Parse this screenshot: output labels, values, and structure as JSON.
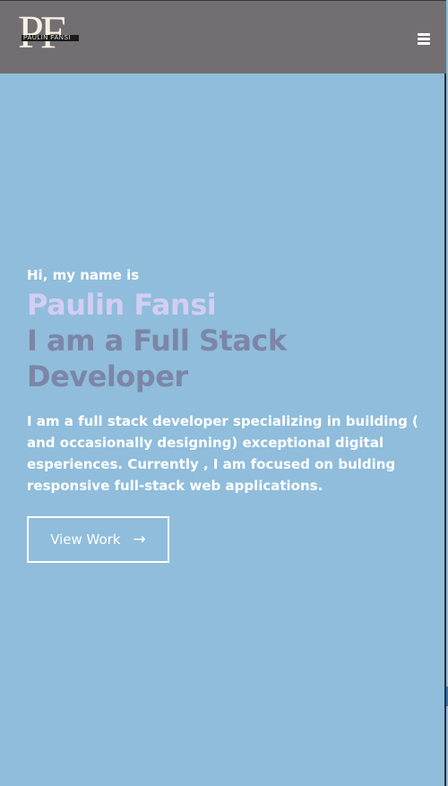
{
  "header": {
    "logo_letters": "PF",
    "logo_text": "PAULIN FANSI",
    "menu_icon": "hamburger-menu-icon"
  },
  "hero": {
    "greeting": "Hi, my name is",
    "name": "Paulin Fansi",
    "role": "I am a Full Stack Developer",
    "bio": "I am a full stack developer specializing in building ( and occasionally designing) exceptional digital esperiences. Currently , I am focused on bulding responsive full-stack web applications.",
    "cta_label": "View Work",
    "cta_icon": "arrow-right-icon"
  },
  "colors": {
    "header_bg": "#726e71",
    "page_bg": "#8fbddb",
    "name_color": "#d2cdf3",
    "role_color": "#7c86a7",
    "text_color": "#ffffff"
  }
}
